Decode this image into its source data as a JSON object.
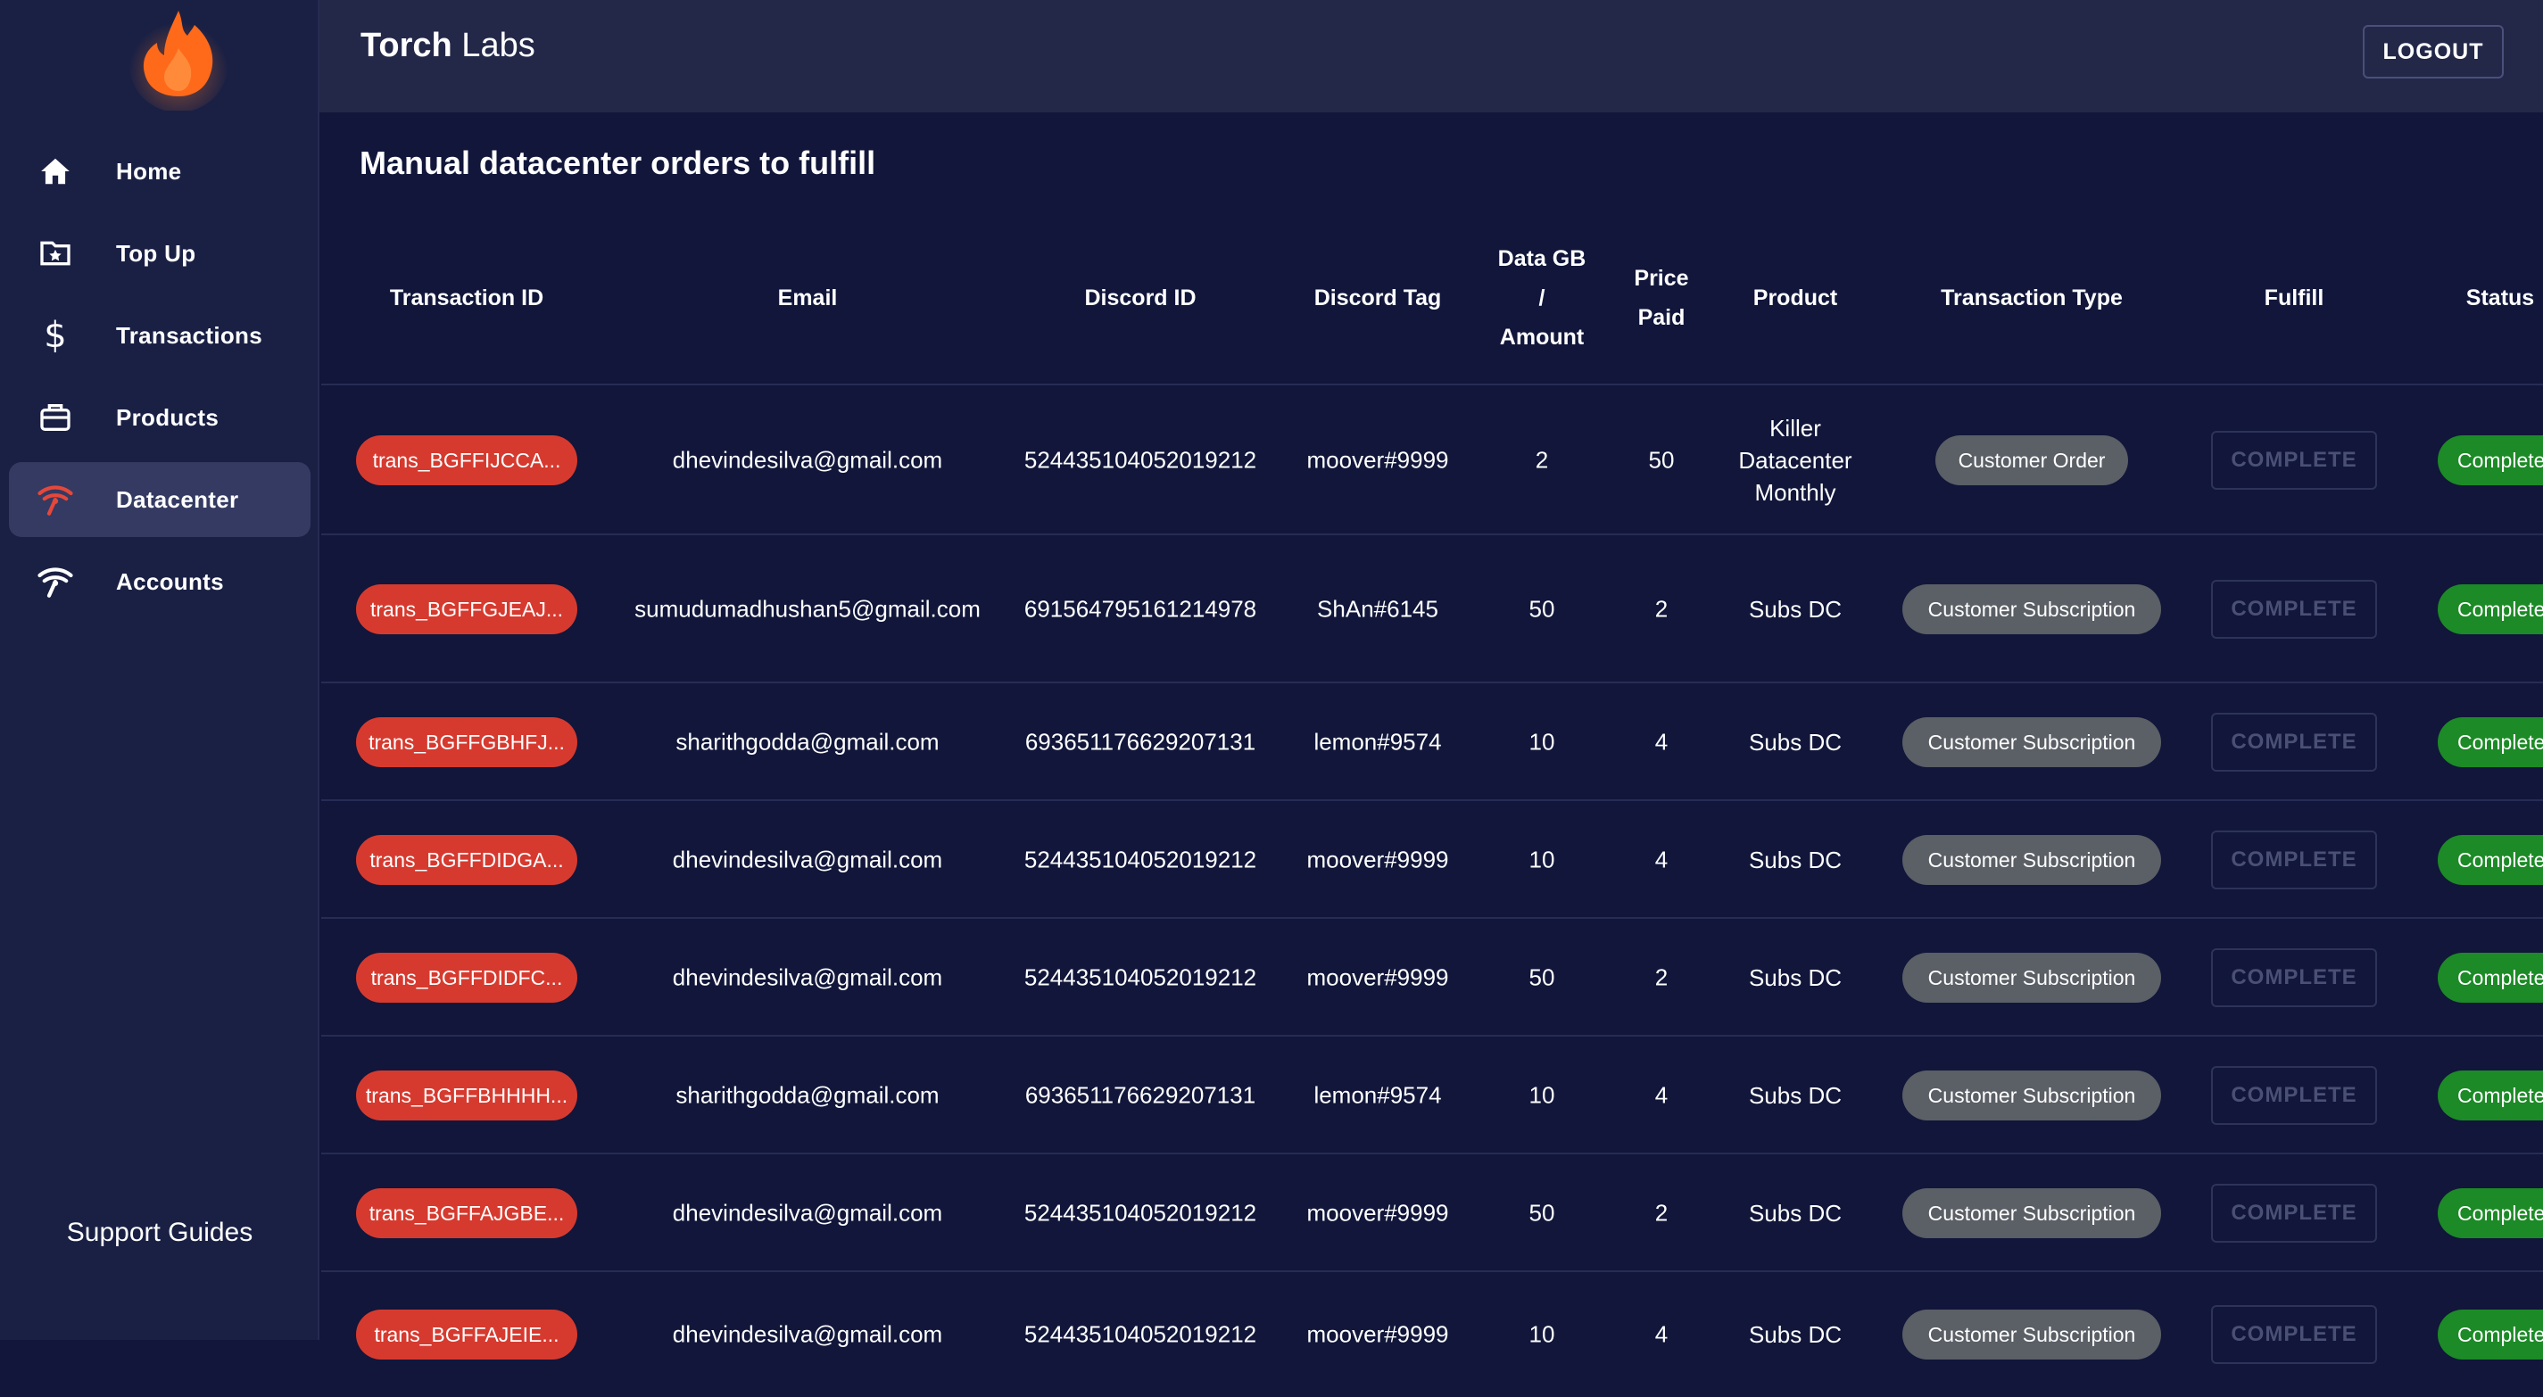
{
  "app": {
    "brand_bold": "Torch",
    "brand_light": " Labs",
    "logout": "LOGOUT"
  },
  "sidebar": {
    "items": [
      {
        "label": "Home",
        "icon": "home-icon"
      },
      {
        "label": "Top Up",
        "icon": "folder-star-icon"
      },
      {
        "label": "Transactions",
        "icon": "dollar-icon"
      },
      {
        "label": "Products",
        "icon": "briefcase-icon"
      },
      {
        "label": "Datacenter",
        "icon": "wifi-icon",
        "active": true
      },
      {
        "label": "Accounts",
        "icon": "wifi-icon"
      }
    ],
    "support": "Support Guides"
  },
  "page": {
    "title": "Manual datacenter orders to fulfill"
  },
  "table": {
    "headers": [
      "Transaction ID",
      "Email",
      "Discord ID",
      "Discord Tag",
      "Data GB / Amount",
      "Price Paid",
      "Product",
      "Transaction Type",
      "Fulfill",
      "Status"
    ],
    "rows": [
      {
        "tx": "trans_BGFFIJCCA...",
        "email": "dhevindesilva@gmail.com",
        "discord_id": "524435104052019212",
        "tag": "moover#9999",
        "amount": "2",
        "price": "50",
        "product": "Killer Datacenter Monthly",
        "type": "Customer Order",
        "fulfill": "COMPLETE",
        "status": "Complete"
      },
      {
        "tx": "trans_BGFFGJEAJ...",
        "email": "sumudumadhushan5@gmail.com",
        "discord_id": "691564795161214978",
        "tag": "ShAn#6145",
        "amount": "50",
        "price": "2",
        "product": "Subs DC",
        "type": "Customer Subscription",
        "fulfill": "COMPLETE",
        "status": "Complete"
      },
      {
        "tx": "trans_BGFFGBHFJ...",
        "email": "sharithgodda@gmail.com",
        "discord_id": "693651176629207131",
        "tag": "lemon#9574",
        "amount": "10",
        "price": "4",
        "product": "Subs DC",
        "type": "Customer Subscription",
        "fulfill": "COMPLETE",
        "status": "Complete"
      },
      {
        "tx": "trans_BGFFDIDGA...",
        "email": "dhevindesilva@gmail.com",
        "discord_id": "524435104052019212",
        "tag": "moover#9999",
        "amount": "10",
        "price": "4",
        "product": "Subs DC",
        "type": "Customer Subscription",
        "fulfill": "COMPLETE",
        "status": "Complete"
      },
      {
        "tx": "trans_BGFFDIDFC...",
        "email": "dhevindesilva@gmail.com",
        "discord_id": "524435104052019212",
        "tag": "moover#9999",
        "amount": "50",
        "price": "2",
        "product": "Subs DC",
        "type": "Customer Subscription",
        "fulfill": "COMPLETE",
        "status": "Complete"
      },
      {
        "tx": "trans_BGFFBHHHH...",
        "email": "sharithgodda@gmail.com",
        "discord_id": "693651176629207131",
        "tag": "lemon#9574",
        "amount": "10",
        "price": "4",
        "product": "Subs DC",
        "type": "Customer Subscription",
        "fulfill": "COMPLETE",
        "status": "Complete"
      },
      {
        "tx": "trans_BGFFAJGBE...",
        "email": "dhevindesilva@gmail.com",
        "discord_id": "524435104052019212",
        "tag": "moover#9999",
        "amount": "50",
        "price": "2",
        "product": "Subs DC",
        "type": "Customer Subscription",
        "fulfill": "COMPLETE",
        "status": "Complete"
      },
      {
        "tx": "trans_BGFFAJEIE...",
        "email": "dhevindesilva@gmail.com",
        "discord_id": "524435104052019212",
        "tag": "moover#9999",
        "amount": "10",
        "price": "4",
        "product": "Subs DC",
        "type": "Customer Subscription",
        "fulfill": "COMPLETE",
        "status": "Complete"
      }
    ]
  },
  "colors": {
    "accent_red": "#d63a2f",
    "status_green": "#1c8a26",
    "type_pill": "#5b5f66"
  }
}
